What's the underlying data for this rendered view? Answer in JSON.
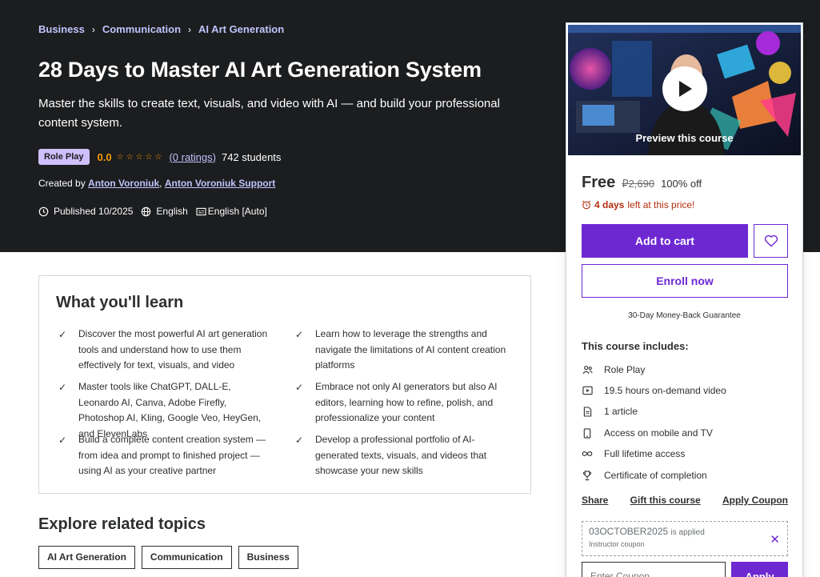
{
  "breadcrumb": [
    "Business",
    "Communication",
    "AI Art Generation"
  ],
  "course": {
    "title": "28 Days to Master AI Art Generation System",
    "subtitle": "Master the skills to create text, visuals, and video with AI — and build your professional content system.",
    "badge": "Role Play",
    "rating": "0.0",
    "ratings_link": "(0 ratings)",
    "students": "742 students",
    "created_label": "Created by",
    "instructor_1": "Anton Voroniuk",
    "instructor_sep": ",",
    "instructor_2": "Anton Voroniuk Support",
    "published": "Published 10/2025",
    "language": "English",
    "captions": "English [Auto]"
  },
  "learn": {
    "title": "What you'll learn",
    "items": [
      "Discover the most powerful AI art generation tools and understand how to use them effectively for text, visuals, and video",
      "Learn how to leverage the strengths and navigate the limitations of AI content creation platforms",
      "Master tools like ChatGPT, DALL-E, Leonardo AI, Canva, Adobe Firefly, Photoshop AI, Kling, Google Veo, HeyGen, and ElevenLabs",
      "Embrace not only AI generators but also AI editors, learning how to refine, polish, and professionalize your content",
      "Build a complete content creation system — from idea and prompt to finished project — using AI as your creative partner",
      "Develop a professional portfolio of AI-generated texts, visuals, and videos that showcase your new skills"
    ]
  },
  "explore": {
    "title": "Explore related topics",
    "topics": [
      "AI Art Generation",
      "Communication",
      "Business"
    ]
  },
  "sidebar": {
    "preview_label": "Preview this course",
    "price": "Free",
    "original_price": "₽2,690",
    "discount": "100% off",
    "timer_bold": "4 days",
    "timer_rest": "left at this price!",
    "add_to_cart": "Add to cart",
    "enroll": "Enroll now",
    "guarantee": "30-Day Money-Back Guarantee",
    "includes_title": "This course includes:",
    "includes": [
      {
        "icon": "role-play-icon",
        "label": "Role Play"
      },
      {
        "icon": "video-icon",
        "label": "19.5 hours on-demand video"
      },
      {
        "icon": "article-icon",
        "label": "1 article"
      },
      {
        "icon": "mobile-icon",
        "label": "Access on mobile and TV"
      },
      {
        "icon": "infinity-icon",
        "label": "Full lifetime access"
      },
      {
        "icon": "trophy-icon",
        "label": "Certificate of completion"
      }
    ],
    "share": "Share",
    "gift": "Gift this course",
    "apply_coupon": "Apply Coupon",
    "coupon_code": "03OCTOBER2025",
    "coupon_applied": "is applied",
    "coupon_type": "Instructor coupon",
    "coupon_placeholder": "Enter Coupon",
    "apply": "Apply"
  },
  "colors": {
    "hero_bg": "#1c1d1f",
    "accent": "#6d28d2",
    "link_light": "#c0c4fc",
    "star": "#f69c08",
    "alert": "#b32d0f"
  }
}
